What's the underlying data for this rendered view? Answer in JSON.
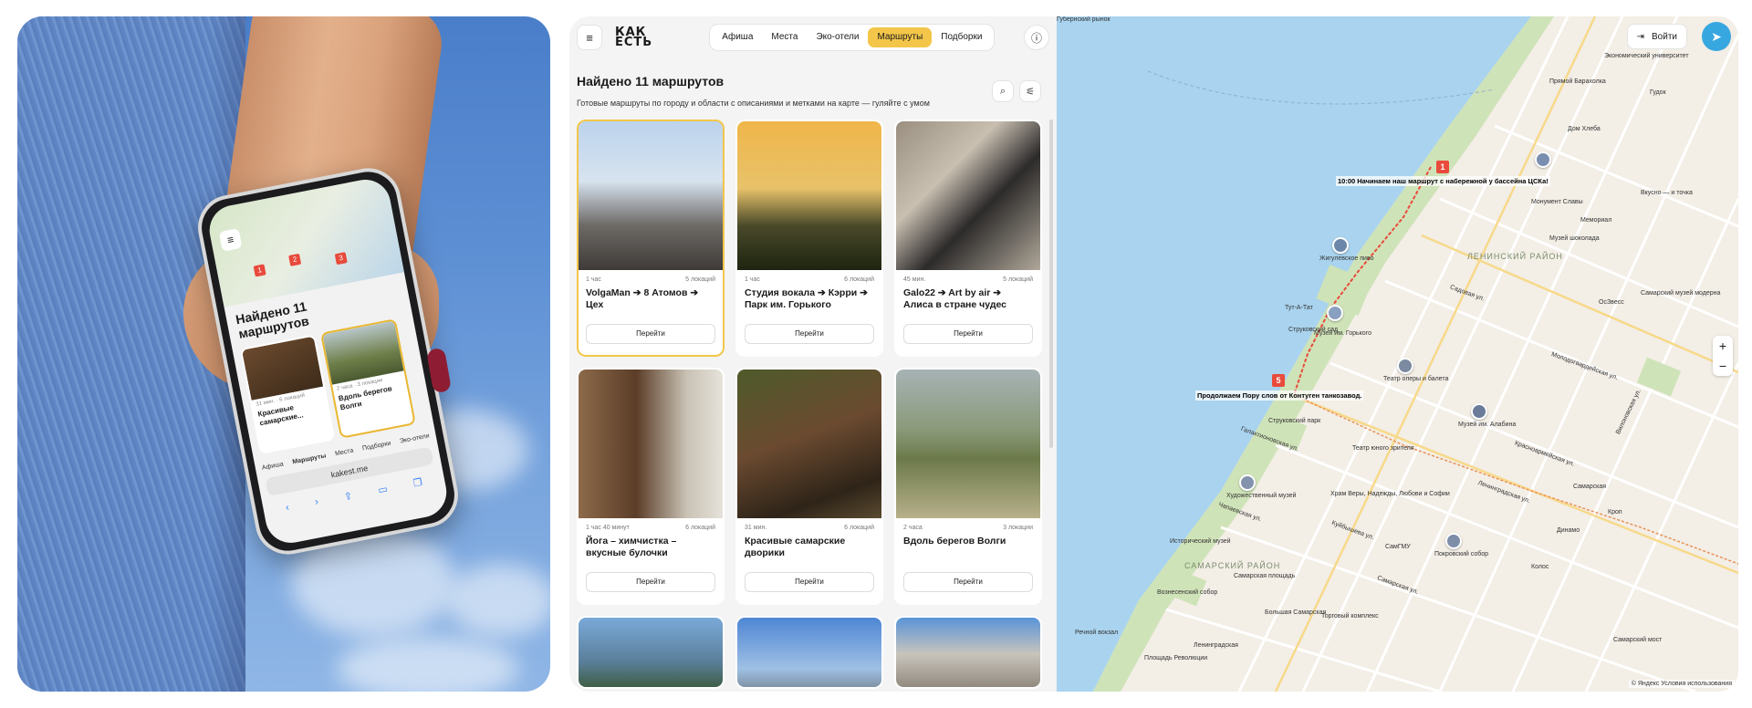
{
  "phone": {
    "title": "Найдено 11 маршрутов",
    "markers": [
      "1",
      "2",
      "3"
    ],
    "cards": [
      {
        "duration": "31 мин.",
        "locations": "6 локаций",
        "name": "Красивые самарские..."
      },
      {
        "duration": "2 часа",
        "locations": "3 локации",
        "name": "Вдоль берегов Волги"
      }
    ],
    "tabs": [
      "Афиша",
      "Маршруты",
      "Места",
      "Подборки",
      "Эко-отели"
    ],
    "url": "kakest.me"
  },
  "app": {
    "logo_line1": "КАК",
    "logo_line2": "ЕСТЬ",
    "tabs": [
      {
        "label": "Афиша"
      },
      {
        "label": "Места"
      },
      {
        "label": "Эко-отели"
      },
      {
        "label": "Маршруты"
      },
      {
        "label": "Подборки"
      }
    ],
    "found_title": "Найдено 11 маршрутов",
    "subtitle": "Готовые маршруты по городу и области с описаниями и метками на карте — гуляйте с умом",
    "go_label": "Перейти",
    "cards": [
      {
        "duration": "1 час",
        "locations": "5 локаций",
        "name": "VolgaMan ➔ 8 Атомов ➔ Цех"
      },
      {
        "duration": "1 час",
        "locations": "6 локаций",
        "name": "Студия вокала ➔ Кэрри ➔ Парк им. Горького"
      },
      {
        "duration": "45 мин.",
        "locations": "5 локаций",
        "name": "Galo22 ➔ Art by air ➔ Алиса в стране чудес"
      },
      {
        "duration": "1 час 40 минут",
        "locations": "6 локаций",
        "name": "Йога – химчистка – вкусные булочки"
      },
      {
        "duration": "31 мин.",
        "locations": "6 локаций",
        "name": "Красивые самарские дворики"
      },
      {
        "duration": "2 часа",
        "locations": "3 локации",
        "name": "Вдоль берегов Волги"
      }
    ]
  },
  "map": {
    "login_label": "Войти",
    "route_start_label": "10:00 Начинаем наш маршрут с набережной у бассейна ЦСКа!",
    "route_mid_label": "Продолжаем Пору слов от Контуген танкозавод.",
    "marker_1": "1",
    "marker_5": "5",
    "districts": [
      "ЛЕНИНСКИЙ РАЙОН",
      "САМАРСКИЙ РАЙОН"
    ],
    "labels": [
      "Прямой Барахолка",
      "Жигулевское пиво",
      "Театр оперы и балета",
      "Музей им. Алабина",
      "Художественный музей",
      "Покровский собор",
      "Дом Хлеба",
      "Самарский музей модерна",
      "Струковский сад",
      "Речной вокзал",
      "Тут-А-Тат",
      "Колос",
      "Кроп",
      "Динамо",
      "Храм Веры, Надежды, Любови и Софии",
      "Театр юного зрителя",
      "Исторический музей",
      "Вознесенский собор",
      "Большая Самарская",
      "Торговый комплекс",
      "Самарская",
      "Ленинградская",
      "Площадь Революции",
      "Струковский парк",
      "Музей им. Горького",
      "Экономический университет",
      "Самарский мост",
      "Мемориал",
      "Гудок",
      "СамГМУ",
      "Монумент Славы",
      "Музей шоколада",
      "Самарская площадь",
      "ОсЗвесс",
      "Вкусно — и точка",
      "Губернский рынок",
      "Красноармейская ул.",
      "Ленинградская ул.",
      "Галактионовская ул.",
      "Чапаевская ул.",
      "Куйбышева ул.",
      "Молодогвардейская ул.",
      "Садовая ул.",
      "Вилоновская ул.",
      "Самарская ул."
    ],
    "copyright": "© Яндекс Условия использования"
  },
  "colors": {
    "accent": "#f3c64a",
    "route_red": "#e94b3c",
    "water": "#a9d3ee",
    "telegram": "#37a7e0"
  }
}
